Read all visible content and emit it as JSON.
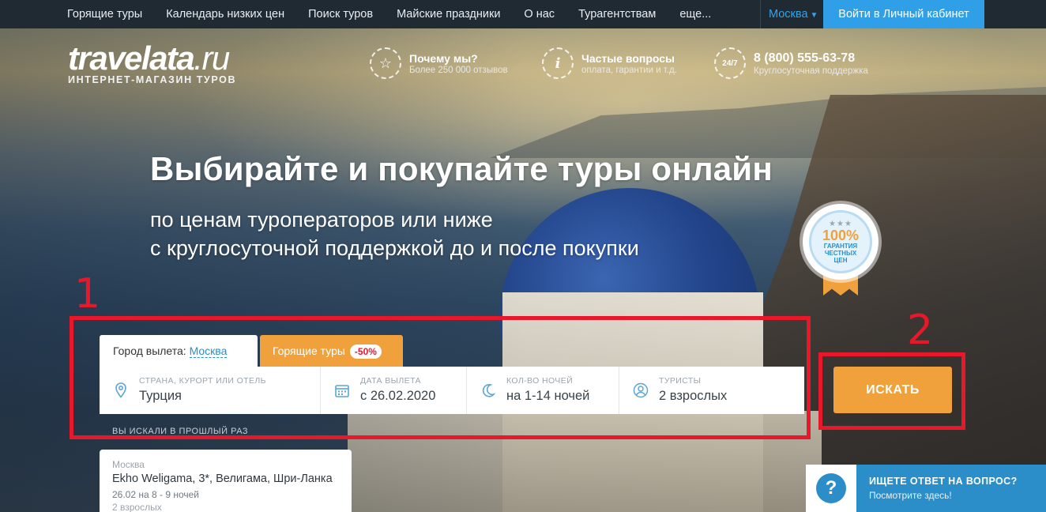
{
  "nav": {
    "items": [
      "Горящие туры",
      "Календарь низких цен",
      "Поиск туров",
      "Майские праздники",
      "О нас",
      "Турагентствам",
      "еще..."
    ],
    "city": "Москва",
    "login": "Войти в Личный кабинет"
  },
  "logo": {
    "name": "travelata",
    "tld": ".ru",
    "tagline": "ИНТЕРНЕТ-МАГАЗИН ТУРОВ"
  },
  "features": [
    {
      "icon": "star-icon",
      "title": "Почему мы?",
      "sub": "Более 250 000 отзывов"
    },
    {
      "icon": "info-icon",
      "title": "Частые вопросы",
      "sub": "оплата, гарантии и т.д."
    },
    {
      "icon": "support-24-7-icon",
      "badge": "24/7",
      "title": "8 (800) 555-63-78",
      "sub": "Круглосуточная поддержка"
    }
  ],
  "hero": {
    "title": "Выбирайте и покупайте туры онлайн",
    "line1": "по ценам туроператоров или ниже",
    "line2": "с круглосуточной поддержкой до и после покупки"
  },
  "badge": {
    "stars": "★★★",
    "percent": "100%",
    "line1": "ГАРАНТИЯ",
    "line2": "ЧЕСТНЫХ",
    "line3": "ЦЕН"
  },
  "annotations": {
    "n1": "1",
    "n2": "2",
    "color": "#e8182a"
  },
  "search": {
    "city_label": "Город вылета:",
    "city_value": "Москва",
    "hot_label": "Горящие туры",
    "hot_discount": "-50%",
    "destination": {
      "caption": "СТРАНА, КУРОРТ ИЛИ ОТЕЛЬ",
      "value": "Турция"
    },
    "date": {
      "caption": "ДАТА ВЫЛЕТА",
      "value": "с 26.02.2020"
    },
    "nights": {
      "caption": "КОЛ-ВО НОЧЕЙ",
      "value": "на 1-14 ночей"
    },
    "tourists": {
      "caption": "ТУРИСТЫ",
      "value": "2 взрослых"
    },
    "button": "ИСКАТЬ"
  },
  "recent": {
    "label": "ВЫ ИСКАЛИ В ПРОШЛЫЙ РАЗ",
    "card": {
      "from": "Москва",
      "hotel": "Ekho Weligama, 3*, Велигама, Шри-Ланка",
      "dates": "26.02 на 8 - 9 ночей",
      "people": "2 взрослых"
    }
  },
  "help": {
    "title": "ИЩЕТЕ ОТВЕТ НА ВОПРОС?",
    "sub": "Посмотрите здесь!"
  },
  "colors": {
    "accent": "#2fa0e8",
    "orange": "#f0a13b",
    "nav_bg": "#1f2a33"
  }
}
